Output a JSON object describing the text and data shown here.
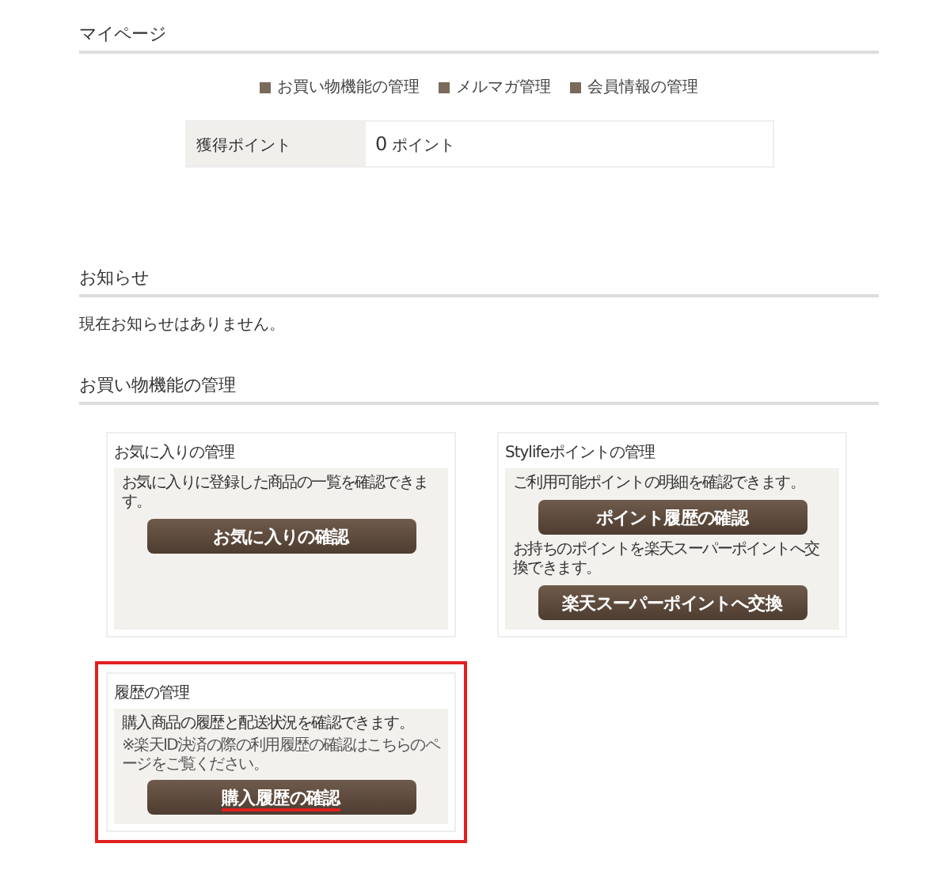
{
  "page_title": "マイページ",
  "quick_links": [
    "お買い物機能の管理",
    "メルマガ管理",
    "会員情報の管理"
  ],
  "points": {
    "label": "獲得ポイント",
    "value": "0",
    "unit": "ポイント"
  },
  "notices": {
    "title": "お知らせ",
    "message": "現在お知らせはありません。"
  },
  "shopping": {
    "title": "お買い物機能の管理",
    "cards": [
      {
        "title": "お気に入りの管理",
        "highlighted": false,
        "blocks": [
          {
            "kind": "text",
            "text": "お気に入りに登録した商品の一覧を確認できます。"
          },
          {
            "kind": "button",
            "text": "お気に入りの確認",
            "underlined": false
          }
        ]
      },
      {
        "title": "Stylifeポイントの管理",
        "highlighted": false,
        "blocks": [
          {
            "kind": "text",
            "text": "ご利用可能ポイントの明細を確認できます。"
          },
          {
            "kind": "button",
            "text": "ポイント履歴の確認",
            "underlined": false
          },
          {
            "kind": "text",
            "text": "お持ちのポイントを楽天スーパーポイントへ交換できます。"
          },
          {
            "kind": "button",
            "text": "楽天スーパーポイントへ交換",
            "underlined": false
          }
        ]
      },
      {
        "title": "履歴の管理",
        "highlighted": true,
        "blocks": [
          {
            "kind": "text",
            "text": "購入商品の履歴と配送状況を確認できます。"
          },
          {
            "kind": "note",
            "text": "※楽天ID決済の際の利用履歴の確認はこちらのページをご覧ください。"
          },
          {
            "kind": "button",
            "text": "購入履歴の確認",
            "underlined": true
          }
        ]
      }
    ]
  }
}
